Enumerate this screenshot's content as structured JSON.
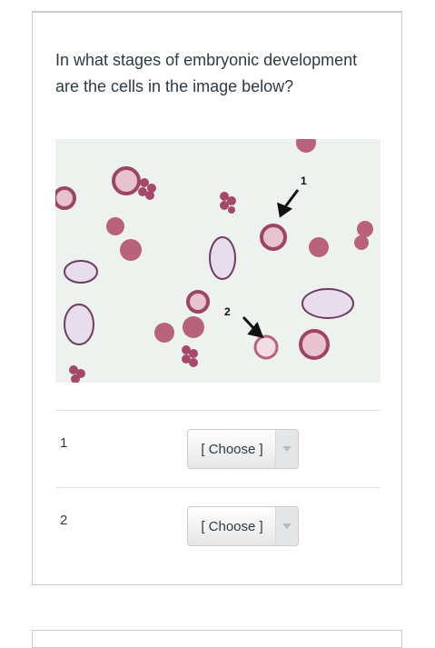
{
  "question": {
    "text": "In what stages of embryonic development are the cells in the image below?"
  },
  "figure": {
    "labels": [
      "1",
      "2"
    ],
    "colors": {
      "background": "#eef2ef",
      "cell": "#b9627d",
      "cell_dark": "#8e3a58",
      "nucleus": "#7b2f4a"
    }
  },
  "answers": [
    {
      "label": "1",
      "select_value": "[ Choose ]"
    },
    {
      "label": "2",
      "select_value": "[ Choose ]"
    }
  ],
  "icons": {
    "select_caret": "chevron-down-icon"
  }
}
